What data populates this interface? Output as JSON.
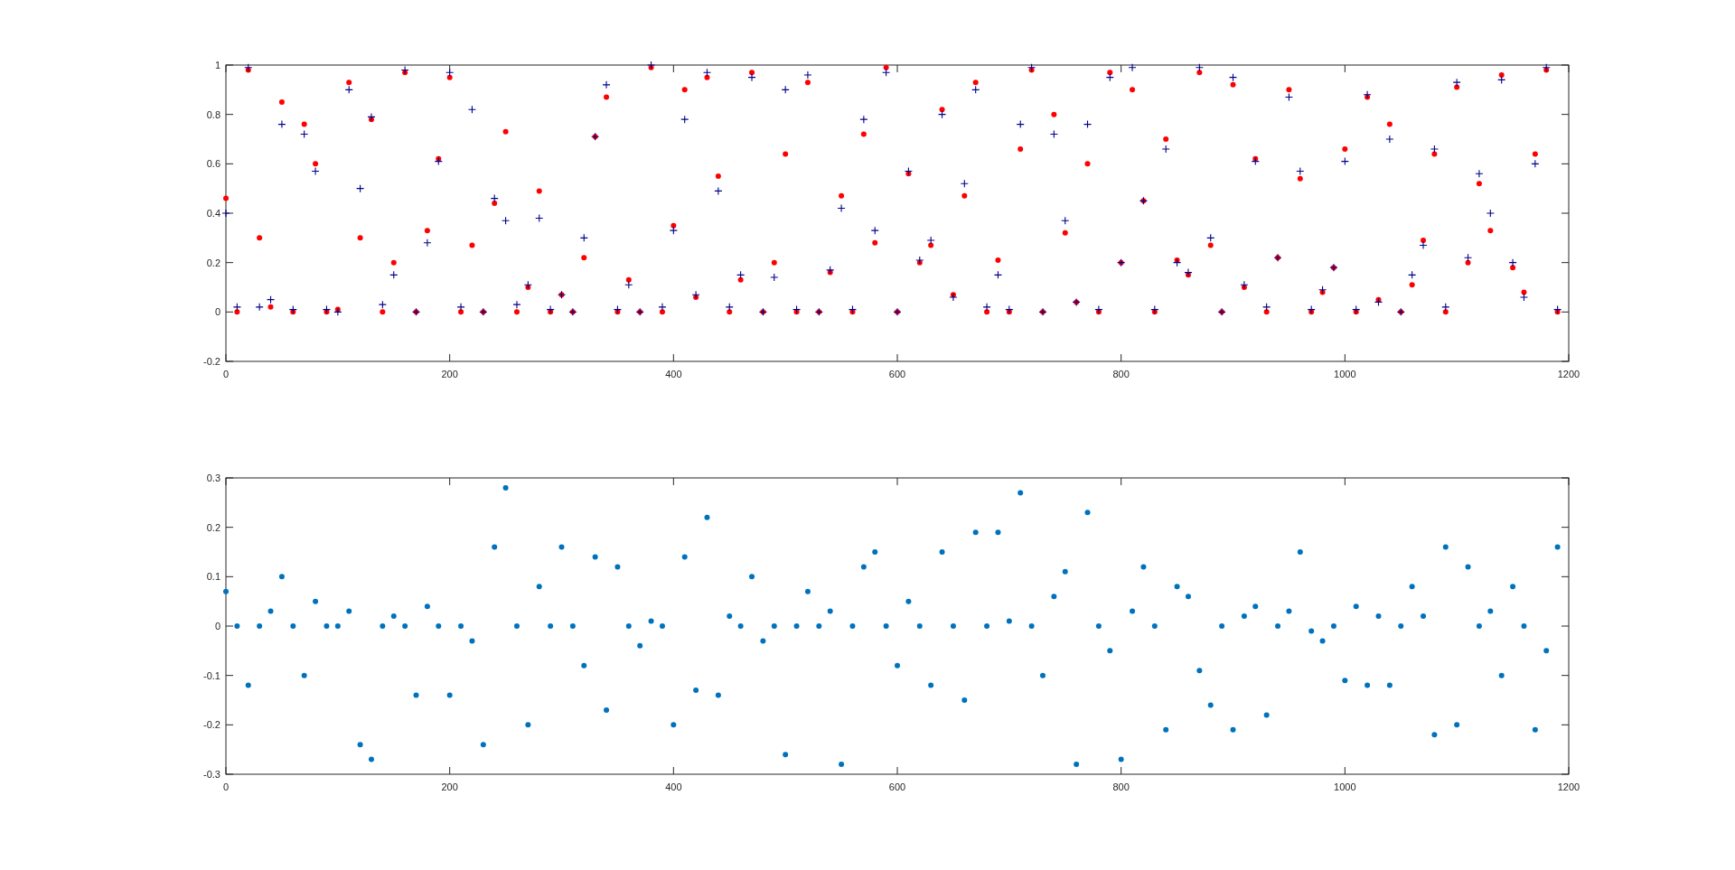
{
  "figure": {
    "plots": [
      {
        "chart_data": {
          "type": "scatter",
          "xlim": [
            0,
            1200
          ],
          "ylim": [
            -0.2,
            1
          ],
          "xticks": [
            0,
            200,
            400,
            600,
            800,
            1000,
            1200
          ],
          "yticks": [
            -0.2,
            0,
            0.2,
            0.4,
            0.6,
            0.8,
            1
          ],
          "x": [
            0,
            10,
            20,
            30,
            40,
            50,
            60,
            70,
            80,
            90,
            100,
            110,
            120,
            130,
            140,
            150,
            160,
            170,
            180,
            190,
            200,
            210,
            220,
            230,
            240,
            250,
            260,
            270,
            280,
            290,
            300,
            310,
            320,
            330,
            340,
            350,
            360,
            370,
            380,
            390,
            400,
            410,
            420,
            430,
            440,
            450,
            460,
            470,
            480,
            490,
            500,
            510,
            520,
            530,
            540,
            550,
            560,
            570,
            580,
            590,
            600,
            610,
            620,
            630,
            640,
            650,
            660,
            670,
            680,
            690,
            700,
            710,
            720,
            730,
            740,
            750,
            760,
            770,
            780,
            790,
            800,
            810,
            820,
            830,
            840,
            850,
            860,
            870,
            880,
            890,
            900,
            910,
            920,
            930,
            940,
            950,
            960,
            970,
            980,
            990,
            1000,
            1010,
            1020,
            1030,
            1040,
            1050,
            1060,
            1070,
            1080,
            1090,
            1100,
            1110,
            1120,
            1130,
            1140,
            1150,
            1160,
            1170,
            1180,
            1190
          ],
          "series": [
            {
              "color": "#ff0000",
              "values": [
                0.46,
                0,
                0.98,
                0.3,
                0.02,
                0.85,
                0,
                0.76,
                0.6,
                0,
                0.01,
                0.93,
                0.3,
                0.78,
                0,
                0.2,
                0.97,
                0,
                0.33,
                0.62,
                0.95,
                0,
                0.27,
                0,
                0.44,
                0.73,
                0,
                0.1,
                0.49,
                0,
                0.07,
                0,
                0.22,
                0.71,
                0.87,
                0,
                0.13,
                0,
                0.99,
                0,
                0.35,
                0.9,
                0.06,
                0.95,
                0.55,
                0,
                0.13,
                0.97,
                0,
                0.2,
                0.64,
                0,
                0.93,
                0,
                0.16,
                0.47,
                0,
                0.72,
                0.28,
                0.99,
                0,
                0.56,
                0.2,
                0.27,
                0.82,
                0.07,
                0.47,
                0.93,
                0,
                0.21,
                0,
                0.66,
                0.98,
                0,
                0.8,
                0.32,
                0.04,
                0.6,
                0,
                0.97,
                0.2,
                0.9,
                0.45,
                0,
                0.7,
                0.21,
                0.15,
                0.97,
                0.27,
                0,
                0.92,
                0.1,
                0.62,
                0,
                0.22,
                0.9,
                0.54,
                0,
                0.08,
                0.18,
                0.66,
                0,
                0.87,
                0.05,
                0.76,
                0,
                0.11,
                0.29,
                0.64,
                0,
                0.91,
                0.2,
                0.52,
                0.33,
                0.96,
                0.18,
                0.08,
                0.64,
                0.98,
                0
              ]
            },
            {
              "color": "#00008b",
              "values": [
                0.4,
                0.02,
                0.99,
                0.02,
                0.05,
                0.76,
                0.01,
                0.72,
                0.57,
                0.01,
                0,
                0.9,
                0.5,
                0.79,
                0.03,
                0.15,
                0.98,
                0,
                0.28,
                0.61,
                0.97,
                0.02,
                0.82,
                0,
                0.46,
                0.37,
                0.03,
                0.11,
                0.38,
                0.01,
                0.07,
                0,
                0.3,
                0.71,
                0.92,
                0.01,
                0.11,
                0,
                1,
                0.02,
                0.33,
                0.78,
                0.07,
                0.97,
                0.49,
                0.02,
                0.15,
                0.95,
                0,
                0.14,
                0.9,
                0.01,
                0.96,
                0,
                0.17,
                0.42,
                0.01,
                0.78,
                0.33,
                0.97,
                0,
                0.57,
                0.21,
                0.29,
                0.8,
                0.06,
                0.52,
                0.9,
                0.02,
                0.15,
                0.01,
                0.76,
                0.99,
                0,
                0.72,
                0.37,
                0.04,
                0.76,
                0.01,
                0.95,
                0.2,
                0.99,
                0.45,
                0.01,
                0.66,
                0.2,
                0.16,
                0.99,
                0.3,
                0,
                0.95,
                0.11,
                0.61,
                0.02,
                0.22,
                0.87,
                0.57,
                0.01,
                0.09,
                0.18,
                0.61,
                0.01,
                0.88,
                0.04,
                0.7,
                0,
                0.15,
                0.27,
                0.66,
                0.02,
                0.93,
                0.22,
                0.56,
                0.4,
                0.94,
                0.2,
                0.06,
                0.6,
                0.99,
                0.01
              ]
            }
          ]
        }
      },
      {
        "chart_data": {
          "type": "scatter",
          "xlim": [
            0,
            1200
          ],
          "ylim": [
            -0.3,
            0.3
          ],
          "xticks": [
            0,
            200,
            400,
            600,
            800,
            1000,
            1200
          ],
          "yticks": [
            -0.3,
            -0.2,
            -0.1,
            0,
            0.1,
            0.2,
            0.3
          ],
          "x": [
            0,
            10,
            20,
            30,
            40,
            50,
            60,
            70,
            80,
            90,
            100,
            110,
            120,
            130,
            140,
            150,
            160,
            170,
            180,
            190,
            200,
            210,
            220,
            230,
            240,
            250,
            260,
            270,
            280,
            290,
            300,
            310,
            320,
            330,
            340,
            350,
            360,
            370,
            380,
            390,
            400,
            410,
            420,
            430,
            440,
            450,
            460,
            470,
            480,
            490,
            500,
            510,
            520,
            530,
            540,
            550,
            560,
            570,
            580,
            590,
            600,
            610,
            620,
            630,
            640,
            650,
            660,
            670,
            680,
            690,
            700,
            710,
            720,
            730,
            740,
            750,
            760,
            770,
            780,
            790,
            800,
            810,
            820,
            830,
            840,
            850,
            860,
            870,
            880,
            890,
            900,
            910,
            920,
            930,
            940,
            950,
            960,
            970,
            980,
            990,
            1000,
            1010,
            1020,
            1030,
            1040,
            1050,
            1060,
            1070,
            1080,
            1090,
            1100,
            1110,
            1120,
            1130,
            1140,
            1150,
            1160,
            1170,
            1180,
            1190
          ],
          "series": [
            {
              "color": "#0072bd",
              "values": [
                0.07,
                0,
                -0.12,
                0,
                0.03,
                0.1,
                0,
                -0.1,
                0.05,
                0,
                0,
                0.03,
                -0.24,
                -0.27,
                0,
                0.02,
                0,
                -0.14,
                0.04,
                0,
                -0.14,
                0,
                -0.03,
                -0.24,
                0.16,
                0.28,
                0,
                -0.2,
                0.08,
                0,
                0.16,
                0,
                -0.08,
                0.14,
                -0.17,
                0.12,
                0,
                -0.04,
                0.01,
                0,
                -0.2,
                0.14,
                -0.13,
                0.22,
                -0.14,
                0.02,
                0,
                0.1,
                -0.03,
                0,
                -0.26,
                0,
                0.07,
                0,
                0.03,
                -0.28,
                0,
                0.12,
                0.15,
                0,
                -0.08,
                0.05,
                0,
                -0.12,
                0.15,
                0,
                -0.15,
                0.19,
                0,
                0.19,
                0.01,
                0.27,
                0,
                -0.1,
                0.06,
                0.11,
                -0.28,
                0.23,
                0,
                -0.05,
                -0.27,
                0.03,
                0.12,
                0,
                -0.21,
                0.08,
                0.06,
                -0.09,
                -0.16,
                0,
                -0.21,
                0.02,
                0.04,
                -0.18,
                0,
                0.03,
                0.15,
                -0.01,
                -0.03,
                0,
                -0.11,
                0.04,
                -0.12,
                0.02,
                -0.12,
                0,
                0.08,
                0.02,
                -0.22,
                0.16,
                -0.2,
                0.12,
                0,
                0.03,
                -0.1,
                0.08,
                0,
                -0.21,
                -0.05,
                0.16
              ]
            }
          ]
        }
      }
    ]
  }
}
